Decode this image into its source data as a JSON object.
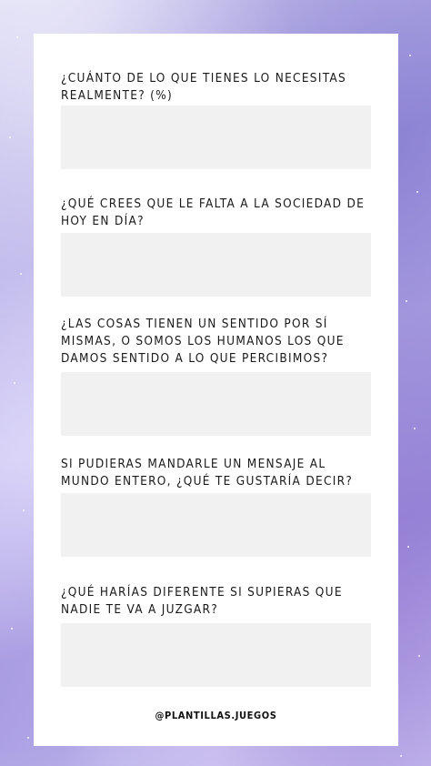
{
  "questions": [
    {
      "text": "¿Cuánto de lo que tienes lo necesitas realmente? (%)"
    },
    {
      "text": "¿Qué crees que le falta a la sociedad de hoy en día?"
    },
    {
      "text": "¿Las cosas tienen un sentido por sí mismas, o somos los humanos los que damos sentido a lo que percibimos?"
    },
    {
      "text": "Si pudieras mandarle un mensaje al mundo entero, ¿qué te gustaría decir?"
    },
    {
      "text": "¿Qué harías diferente si supieras que nadie te va a juzgar?"
    }
  ],
  "footer": {
    "handle": "@PLANTILLAS.JUEGOS"
  },
  "colors": {
    "card": "#ffffff",
    "answer_box": "#f1f1f1",
    "text": "#1a1a1a"
  }
}
